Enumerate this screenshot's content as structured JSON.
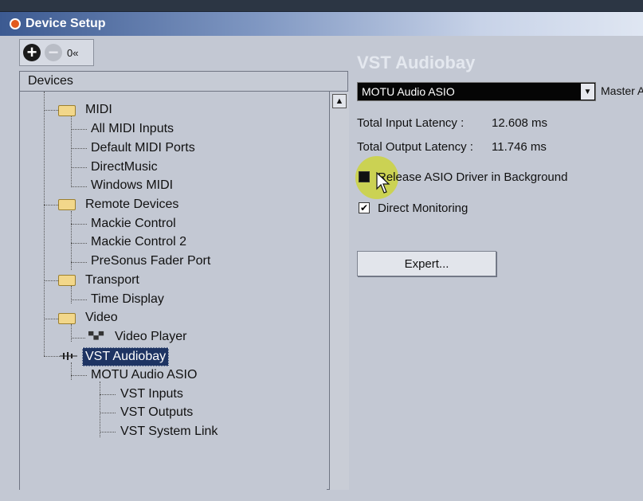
{
  "window": {
    "title": "Device Setup"
  },
  "toolbar": {
    "add_icon": "plus-circle-icon",
    "remove_icon": "minus-circle-icon",
    "reset_label": "0«"
  },
  "devices": {
    "header": "Devices",
    "items": [
      {
        "label": "MIDI",
        "type": "folder"
      },
      {
        "label": "All MIDI Inputs",
        "type": "item"
      },
      {
        "label": "Default MIDI Ports",
        "type": "item"
      },
      {
        "label": "DirectMusic",
        "type": "item"
      },
      {
        "label": "Windows MIDI",
        "type": "item"
      },
      {
        "label": "Remote Devices",
        "type": "folder"
      },
      {
        "label": "Mackie Control",
        "type": "item"
      },
      {
        "label": "Mackie Control 2",
        "type": "item"
      },
      {
        "label": "PreSonus Fader Port",
        "type": "item"
      },
      {
        "label": "Transport",
        "type": "folder"
      },
      {
        "label": "Time Display",
        "type": "item"
      },
      {
        "label": "Video",
        "type": "folder"
      },
      {
        "label": "Video Player",
        "type": "item"
      },
      {
        "label": "VST Audiobay",
        "type": "audio",
        "selected": true
      },
      {
        "label": "MOTU Audio ASIO",
        "type": "item"
      },
      {
        "label": "VST Inputs",
        "type": "item"
      },
      {
        "label": "VST Outputs",
        "type": "item"
      },
      {
        "label": "VST System Link",
        "type": "item"
      }
    ]
  },
  "panel": {
    "title": "VST Audiobay",
    "driver_select": "MOTU Audio ASIO",
    "master_label": "Master A",
    "input_latency_label": "Total Input Latency :",
    "input_latency_value": "12.608 ms",
    "output_latency_label": "Total Output Latency :",
    "output_latency_value": "11.746 ms",
    "release_label": "Release ASIO Driver in Background",
    "release_checked": false,
    "monitoring_label": "Direct Monitoring",
    "monitoring_checked": true,
    "expert_label": "Expert..."
  },
  "colors": {
    "selection": "#1e3463",
    "cursor_highlight": "#ced628",
    "title_gradient": "#3c5a91"
  }
}
